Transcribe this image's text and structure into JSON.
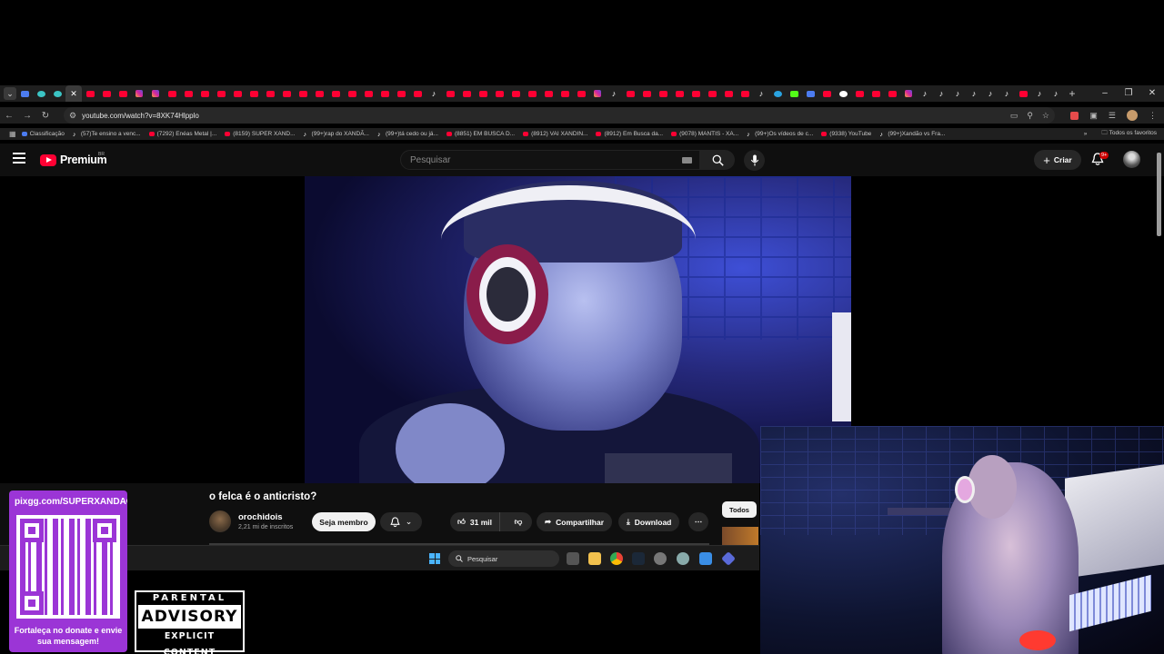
{
  "browser": {
    "tabs": [
      "menu",
      "blue",
      "cyan",
      "cyan",
      "active",
      "yt",
      "yt",
      "yt",
      "ig",
      "ig",
      "yt",
      "yt",
      "yt",
      "yt",
      "yt",
      "yt",
      "yt",
      "yt",
      "yt",
      "yt",
      "yt",
      "yt",
      "yt",
      "yt",
      "yt",
      "yt",
      "tt",
      "yt",
      "yt",
      "yt",
      "yt",
      "yt",
      "yt",
      "yt",
      "yt",
      "yt",
      "ig",
      "tt",
      "yt",
      "yt",
      "yt",
      "yt",
      "yt",
      "yt",
      "yt",
      "yt",
      "tt",
      "tg",
      "kick",
      "blue",
      "yt",
      "gg",
      "yt",
      "yt",
      "yt",
      "ig",
      "tt",
      "tt",
      "tt",
      "tt",
      "tt",
      "tt",
      "yt",
      "tt",
      "tt"
    ],
    "url": "youtube.com/watch?v=8XK74Hlpplo",
    "bookmarks": [
      {
        "icon": "grid",
        "label": "Classificação"
      },
      {
        "icon": "tt",
        "label": "(57)Te ensino a venc..."
      },
      {
        "icon": "yt",
        "label": "(7292) Enéas Metal |..."
      },
      {
        "icon": "yt",
        "label": "(8159) SUPER XAND..."
      },
      {
        "icon": "tt",
        "label": "(99+)rap do XANDÃ..."
      },
      {
        "icon": "tt",
        "label": "(99+)tá cedo ou já..."
      },
      {
        "icon": "yt",
        "label": "(8851) EM BUSCA D..."
      },
      {
        "icon": "yt",
        "label": "(8912) VAI XANDIN..."
      },
      {
        "icon": "yt",
        "label": "(8912) Em Busca da..."
      },
      {
        "icon": "yt",
        "label": "(9078) MANTIS - XA..."
      },
      {
        "icon": "tt",
        "label": "(99+)Os vídeos de c..."
      },
      {
        "icon": "yt",
        "label": "(9338) YouTube"
      },
      {
        "icon": "tt",
        "label": "(99+)Xandão vs Fra..."
      }
    ],
    "all_bookmarks_label": "Todos os favoritos"
  },
  "youtube": {
    "logo_text": "Premium",
    "region": "BR",
    "search_placeholder": "Pesquisar",
    "create_label": "Criar",
    "notif_badge": "9+",
    "video": {
      "title": "o felca é o anticristo?",
      "channel": "orochidois",
      "subscribers": "2,21 mi de inscritos",
      "member_label": "Seja membro",
      "likes": "31 mil",
      "share_label": "Compartilhar",
      "download_label": "Download"
    },
    "chip_all": "Todos"
  },
  "taskbar": {
    "search_placeholder": "Pesquisar"
  },
  "overlay": {
    "donate_url": "pixgg.com/SUPERXANDAO",
    "donate_caption": "Fortaleça no donate e envie sua mensagem!",
    "advisory": {
      "top": "PARENTAL",
      "mid": "ADVISORY",
      "bottom": "EXPLICIT CONTENT"
    }
  },
  "colors": {
    "yt_red": "#ff0033",
    "overlay_purple": "#9b35d6",
    "page_bg": "#0f0f0f"
  }
}
